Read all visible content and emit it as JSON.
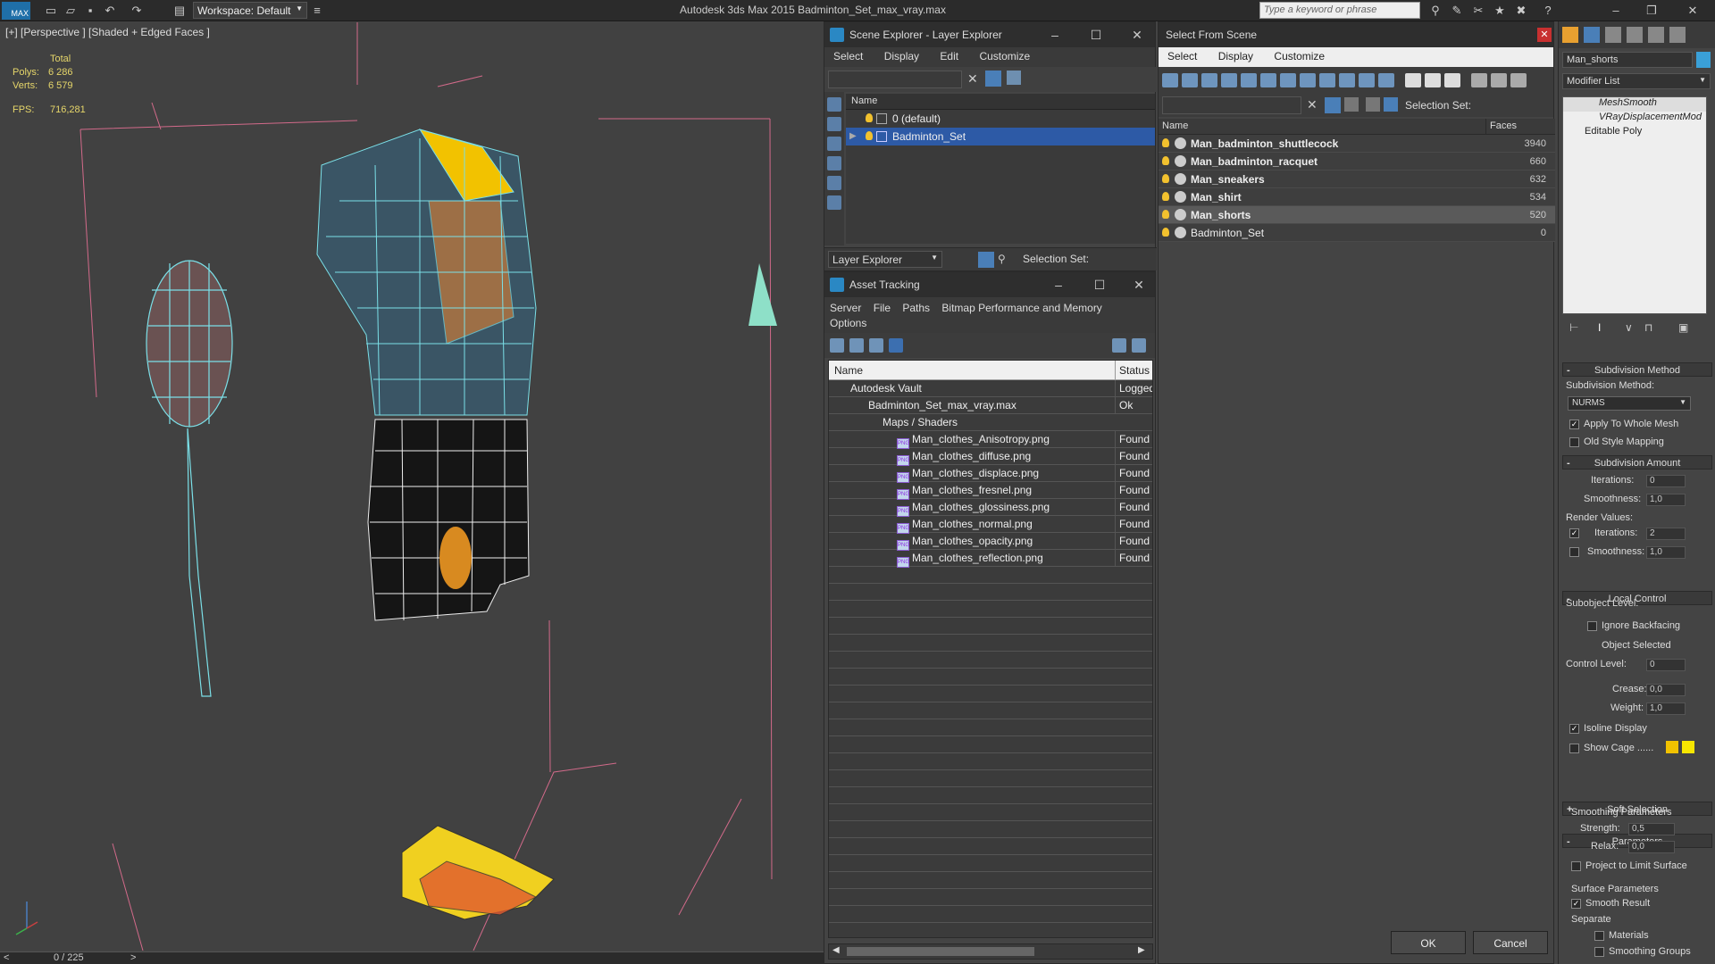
{
  "topbar": {
    "workspace": "Workspace: Default",
    "title": "Autodesk 3ds Max  2015    Badminton_Set_max_vray.max",
    "search_placeholder": "Type a keyword or phrase",
    "logo": "MAX"
  },
  "viewport": {
    "label": "[+] [Perspective ] [Shaded + Edged Faces ]",
    "total_label": "Total",
    "polys_label": "Polys:",
    "polys_value": "6 286",
    "verts_label": "Verts:",
    "verts_value": "6 579",
    "fps_label": "FPS:",
    "fps_value": "716,281"
  },
  "timeline": {
    "frame": "0 / 225",
    "prev": "<",
    "next": ">"
  },
  "scene_explorer": {
    "title": "Scene Explorer - Layer Explorer",
    "menu": [
      "Select",
      "Display",
      "Edit",
      "Customize"
    ],
    "column": "Name",
    "rows": [
      "0 (default)",
      "Badminton_Set"
    ],
    "bottom_label": "Layer Explorer",
    "selection_set": "Selection Set:"
  },
  "asset_tracking": {
    "title": "Asset Tracking",
    "menu": [
      "Server",
      "File",
      "Paths",
      "Bitmap Performance and Memory",
      "Options"
    ],
    "col_name": "Name",
    "col_status": "Status",
    "rows": [
      {
        "name": "Autodesk Vault",
        "status": "Logged"
      },
      {
        "name": "Badminton_Set_max_vray.max",
        "status": "Ok"
      },
      {
        "name": "Maps / Shaders",
        "status": ""
      },
      {
        "name": "Man_clothes_Anisotropy.png",
        "status": "Found"
      },
      {
        "name": "Man_clothes_diffuse.png",
        "status": "Found"
      },
      {
        "name": "Man_clothes_displace.png",
        "status": "Found"
      },
      {
        "name": "Man_clothes_fresnel.png",
        "status": "Found"
      },
      {
        "name": "Man_clothes_glossiness.png",
        "status": "Found"
      },
      {
        "name": "Man_clothes_normal.png",
        "status": "Found"
      },
      {
        "name": "Man_clothes_opacity.png",
        "status": "Found"
      },
      {
        "name": "Man_clothes_reflection.png",
        "status": "Found"
      }
    ]
  },
  "select_from_scene": {
    "title": "Select From Scene",
    "menu": [
      "Select",
      "Display",
      "Customize"
    ],
    "selection_set": "Selection Set:",
    "col_name": "Name",
    "col_faces": "Faces",
    "rows": [
      {
        "name": "Man_badminton_shuttlecock",
        "faces": "3940"
      },
      {
        "name": "Man_badminton_racquet",
        "faces": "660"
      },
      {
        "name": "Man_sneakers",
        "faces": "632"
      },
      {
        "name": "Man_shirt",
        "faces": "534"
      },
      {
        "name": "Man_shorts",
        "faces": "520"
      },
      {
        "name": "Badminton_Set",
        "faces": "0"
      }
    ],
    "ok": "OK",
    "cancel": "Cancel"
  },
  "command_panel": {
    "object_name": "Man_shorts",
    "modifier_list": "Modifier List",
    "stack": [
      "MeshSmooth",
      "VRayDisplacementMod",
      "Editable Poly"
    ],
    "subdiv_method_hdr": "Subdivision Method",
    "subdiv_method_label": "Subdivision Method:",
    "subdiv_method_value": "NURMS",
    "apply_whole_mesh": "Apply To Whole Mesh",
    "old_style_mapping": "Old Style Mapping",
    "subdiv_amount_hdr": "Subdivision Amount",
    "iterations": "Iterations:",
    "iterations_val": "0",
    "smoothness": "Smoothness:",
    "smoothness_val": "1,0",
    "render_values": "Render Values:",
    "r_iterations_val": "2",
    "r_smoothness_val": "1,0",
    "local_control_hdr": "Local Control",
    "subobject_level": "Subobject Level:",
    "ignore_backfacing": "Ignore Backfacing",
    "object_selected": "Object Selected",
    "control_level": "Control Level:",
    "control_level_val": "0",
    "crease": "Crease:",
    "crease_val": "0,0",
    "weight": "Weight:",
    "weight_val": "1,0",
    "isoline_display": "Isoline Display",
    "show_cage": "Show Cage ......",
    "soft_selection_hdr": "Soft Selection",
    "parameters_hdr": "Parameters",
    "smoothing_params": "Smoothing Parameters",
    "strength": "Strength:",
    "strength_val": "0,5",
    "relax": "Relax:",
    "relax_val": "0,0",
    "project_limit": "Project to Limit Surface",
    "surface_params": "Surface Parameters",
    "smooth_result": "Smooth Result",
    "separate": "Separate",
    "materials": "Materials",
    "smoothing_groups": "Smoothing Groups",
    "cage_colors": [
      "#f2c200",
      "#f7e600"
    ]
  }
}
